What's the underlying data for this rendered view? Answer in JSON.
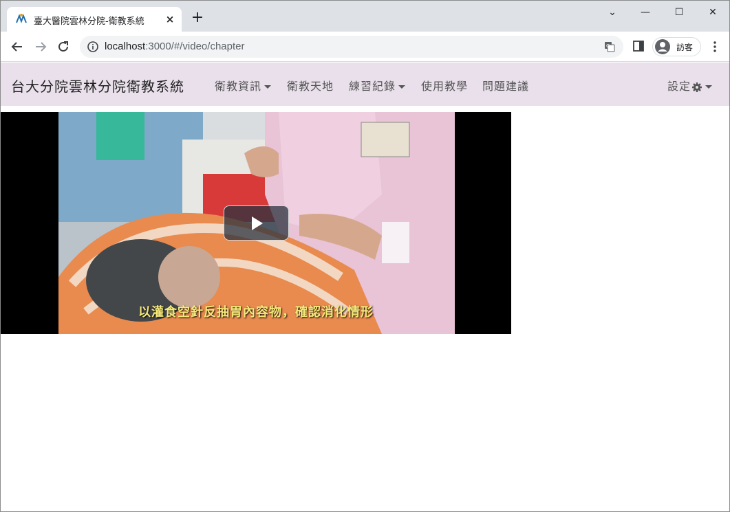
{
  "browser": {
    "tab_title": "臺大醫院雲林分院-衛教系統",
    "tab_close": "×",
    "new_tab": "+",
    "url_host": "localhost",
    "url_rest": ":3000/#/video/chapter",
    "profile_label": "訪客",
    "window_controls": {
      "dropdown": "⌄",
      "minimize": "—",
      "maximize": "☐",
      "close": "✕"
    }
  },
  "navbar": {
    "brand": "台大分院雲林分院衛教系統",
    "items": [
      {
        "label": "衛教資訊",
        "dropdown": true
      },
      {
        "label": "衛教天地",
        "dropdown": false
      },
      {
        "label": "練習紀錄",
        "dropdown": true
      },
      {
        "label": "使用教學",
        "dropdown": false
      },
      {
        "label": "問題建議",
        "dropdown": false
      }
    ],
    "settings_label": "設定"
  },
  "video": {
    "subtitle": "以灌食空針反抽胃內容物，確認消化情形"
  },
  "colors": {
    "navbar_bg": "#e9e0ec",
    "tabstrip_bg": "#dee1e6",
    "subtitle": "#f5e97a"
  }
}
